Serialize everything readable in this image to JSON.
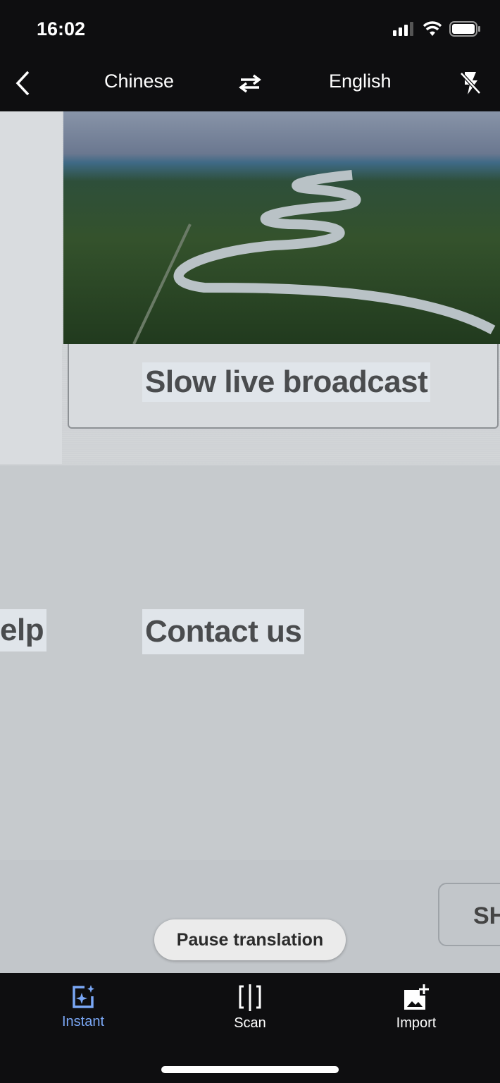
{
  "status_bar": {
    "time": "16:02",
    "icons": [
      "cellular-signal-icon",
      "wifi-icon",
      "battery-icon"
    ]
  },
  "top_bar": {
    "back_icon": "chevron-left-icon",
    "source_language": "Chinese",
    "swap_icon": "swap-arrows-icon",
    "target_language": "English",
    "flash_icon": "flash-off-icon"
  },
  "camera_view": {
    "overlays": [
      "Slow live broadcast",
      "elp",
      "Contact us",
      "SH"
    ]
  },
  "pause_button": {
    "label": "Pause translation"
  },
  "bottom_nav": {
    "accent": "#7aa7f5",
    "items": [
      {
        "label": "Instant",
        "icon": "instant-sparkle-icon",
        "active": true
      },
      {
        "label": "Scan",
        "icon": "scan-icon",
        "active": false
      },
      {
        "label": "Import",
        "icon": "import-image-icon",
        "active": false
      }
    ]
  }
}
